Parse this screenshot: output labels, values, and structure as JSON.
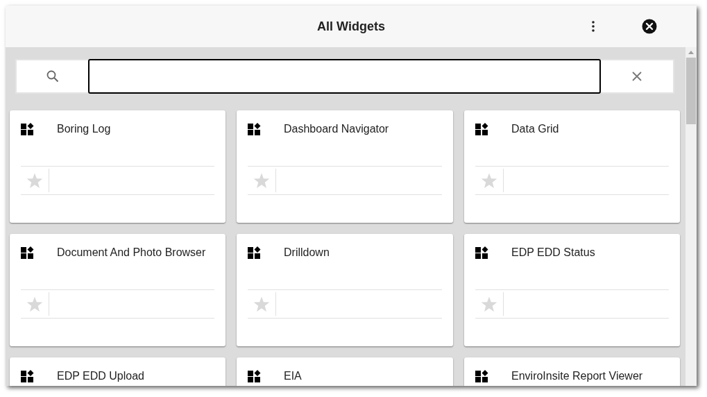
{
  "window": {
    "title": "All Widgets"
  },
  "widgets": [
    {
      "name": "Boring Log",
      "favorite": false
    },
    {
      "name": "Dashboard Navigator",
      "favorite": false
    },
    {
      "name": "Data Grid",
      "favorite": false
    },
    {
      "name": "Document And Photo Browser",
      "favorite": false
    },
    {
      "name": "Drilldown",
      "favorite": false
    },
    {
      "name": "EDP EDD Status",
      "favorite": false
    },
    {
      "name": "EDP EDD Upload"
    },
    {
      "name": "EIA"
    },
    {
      "name": "EnviroInsite Report Viewer"
    }
  ]
}
